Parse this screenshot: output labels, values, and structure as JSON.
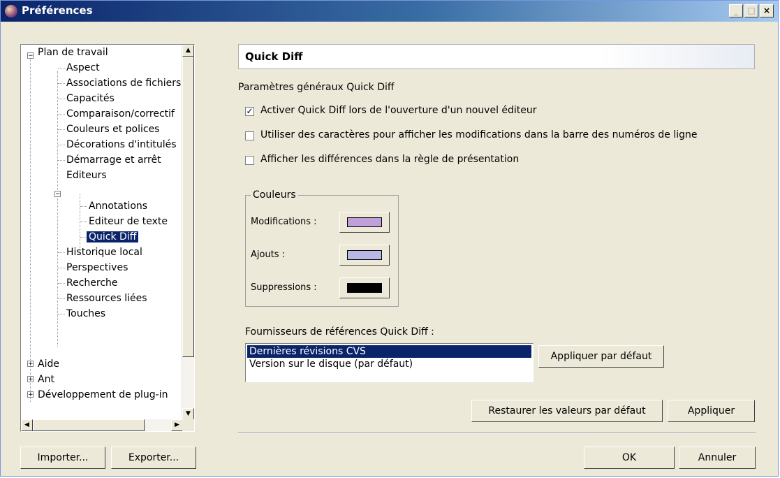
{
  "window": {
    "title": "Préférences",
    "controls": [
      "_",
      "□",
      "×"
    ]
  },
  "tree": {
    "items": [
      {
        "label": "Plan de travail",
        "level": 0,
        "expander": "-"
      },
      {
        "label": "Aspect",
        "level": 1
      },
      {
        "label": "Associations de fichiers",
        "level": 1
      },
      {
        "label": "Capacités",
        "level": 1
      },
      {
        "label": "Comparaison/correctif",
        "level": 1
      },
      {
        "label": "Couleurs et polices",
        "level": 1
      },
      {
        "label": "Décorations d'intitulés",
        "level": 1
      },
      {
        "label": "Démarrage et arrêt",
        "level": 1
      },
      {
        "label": "Editeurs",
        "level": 1,
        "expander": "-"
      },
      {
        "label": "Annotations",
        "level": 2
      },
      {
        "label": "Editeur de texte",
        "level": 2
      },
      {
        "label": "Quick Diff",
        "level": 2,
        "selected": true
      },
      {
        "label": "Historique local",
        "level": 1
      },
      {
        "label": "Perspectives",
        "level": 1
      },
      {
        "label": "Recherche",
        "level": 1
      },
      {
        "label": "Ressources liées",
        "level": 1
      },
      {
        "label": "Touches",
        "level": 1
      },
      {
        "label": "Aide",
        "level": 0,
        "expander": "+"
      },
      {
        "label": "Ant",
        "level": 0,
        "expander": "+"
      },
      {
        "label": "Développement de plug-in",
        "level": 0,
        "expander": "+"
      }
    ]
  },
  "page": {
    "title": "Quick Diff",
    "section_label": "Paramètres généraux Quick Diff",
    "options": [
      {
        "label": "Activer Quick Diff lors de l'ouverture d'un nouvel éditeur",
        "checked": true
      },
      {
        "label": "Utiliser des caractères pour afficher les modifications dans la barre des numéros de ligne",
        "checked": false
      },
      {
        "label": "Afficher les différences dans la règle de présentation",
        "checked": false
      }
    ],
    "colors_group": {
      "title": "Couleurs",
      "items": [
        {
          "label": "Modifications :",
          "color": "#c0a0d8"
        },
        {
          "label": "Ajouts :",
          "color": "#b8b8e8"
        },
        {
          "label": "Suppressions :",
          "color": "#000000"
        }
      ]
    },
    "providers_label": "Fournisseurs de références Quick Diff :",
    "providers": [
      {
        "label": "Dernières révisions CVS",
        "selected": true
      },
      {
        "label": "Version sur le disque (par défaut)",
        "selected": false
      }
    ],
    "set_default_button": "Appliquer par défaut",
    "restore_defaults_button": "Restaurer les valeurs par défaut",
    "apply_button": "Appliquer"
  },
  "footer": {
    "import_button": "Importer...",
    "export_button": "Exporter...",
    "ok_button": "OK",
    "cancel_button": "Annuler"
  },
  "colors": {
    "selection": "#0a246a",
    "dialog_bg": "#ece9d8"
  }
}
